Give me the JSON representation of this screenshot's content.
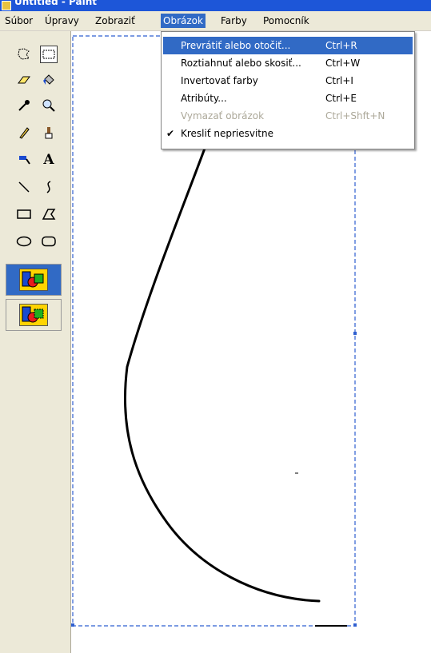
{
  "window": {
    "title": "Untitled - Paint"
  },
  "menubar": {
    "items": [
      "Súbor",
      "Úpravy",
      "Zobraziť",
      "Obrázok",
      "Farby",
      "Pomocník"
    ],
    "active": "Obrázok"
  },
  "image_menu": {
    "items": [
      {
        "label": "Prevrátiť alebo otočiť...",
        "shortcut": "Ctrl+R",
        "highlighted": true,
        "enabled": true,
        "checked": false
      },
      {
        "label": "Roztiahnuť alebo skosiť...",
        "shortcut": "Ctrl+W",
        "highlighted": false,
        "enabled": true,
        "checked": false
      },
      {
        "label": "Invertovať farby",
        "shortcut": "Ctrl+I",
        "highlighted": false,
        "enabled": true,
        "checked": false
      },
      {
        "label": "Atribúty...",
        "shortcut": "Ctrl+E",
        "highlighted": false,
        "enabled": true,
        "checked": false
      },
      {
        "label": "Vymazať obrázok",
        "shortcut": "Ctrl+Shft+N",
        "highlighted": false,
        "enabled": false,
        "checked": false
      },
      {
        "label": "Kresliť nepriesvitne",
        "shortcut": "",
        "highlighted": false,
        "enabled": true,
        "checked": true
      }
    ]
  },
  "toolbox": {
    "tools": [
      {
        "name": "free-form-select-icon",
        "glyph": "☆"
      },
      {
        "name": "rect-select-icon",
        "glyph": ""
      },
      {
        "name": "eraser-icon",
        "glyph": "▱"
      },
      {
        "name": "fill-icon",
        "glyph": "◆"
      },
      {
        "name": "color-picker-icon",
        "glyph": "⁄"
      },
      {
        "name": "magnifier-icon",
        "glyph": "⚲"
      },
      {
        "name": "pencil-icon",
        "glyph": "✎"
      },
      {
        "name": "brush-icon",
        "glyph": "♙"
      },
      {
        "name": "airbrush-icon",
        "glyph": "◥"
      },
      {
        "name": "text-icon",
        "glyph": "A"
      },
      {
        "name": "line-icon",
        "glyph": "╲"
      },
      {
        "name": "curve-icon",
        "glyph": "≀"
      },
      {
        "name": "rectangle-icon",
        "glyph": "▭"
      },
      {
        "name": "polygon-icon",
        "glyph": "◿"
      },
      {
        "name": "ellipse-icon",
        "glyph": "⬭"
      },
      {
        "name": "rounded-rect-icon",
        "glyph": "▢"
      }
    ],
    "selected": "rect-select-icon"
  },
  "colors": {
    "accent": "#316ac5",
    "menubar": "#ece9d8",
    "selection_dash": "#2f5fd0"
  }
}
